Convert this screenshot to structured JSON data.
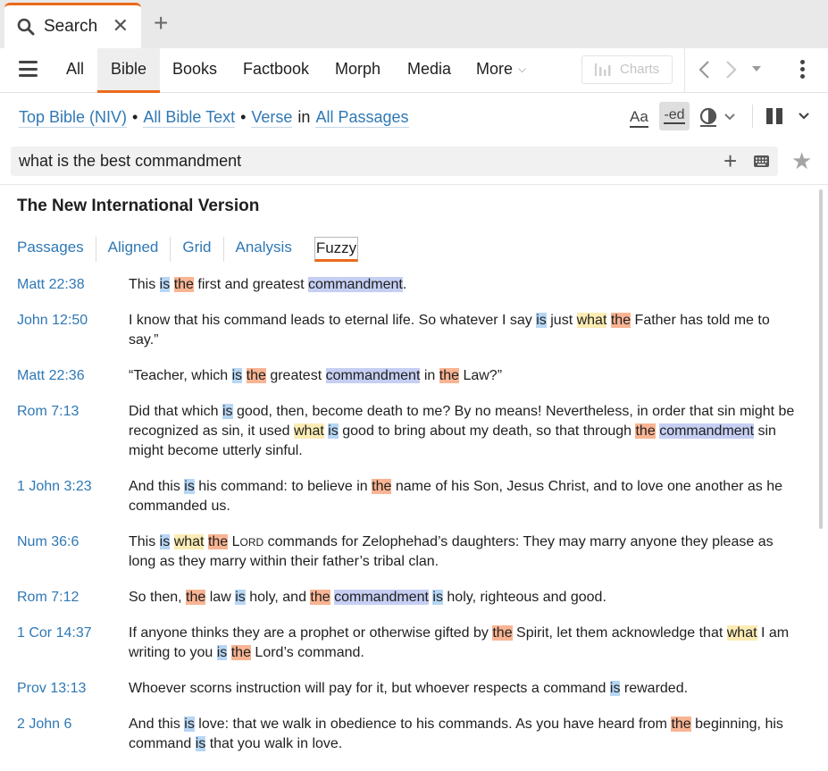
{
  "tab": {
    "label": "Search",
    "close": "✕",
    "icon": "search-icon"
  },
  "new_tab": "+",
  "toolbar": {
    "menu_icon": "hamburger-menu-icon",
    "tabs": [
      "All",
      "Bible",
      "Books",
      "Factbook",
      "Morph",
      "Media",
      "More"
    ],
    "active_tab": "Bible",
    "charts_label": "Charts",
    "back": "‹",
    "forward": "›",
    "history_dropdown": "▾"
  },
  "scope": {
    "bible": "Top Bible (NIV)",
    "sep1": "•",
    "text_scope": "All Bible Text",
    "sep2": "•",
    "unit": "Verse",
    "in": "in",
    "range": "All Passages"
  },
  "search_options": {
    "match_case": "Aa",
    "match_prefix": "-ed"
  },
  "search": {
    "query": "what is the best commandment",
    "add": "+"
  },
  "result": {
    "title": "The New International Version",
    "view_tabs": [
      "Passages",
      "Aligned",
      "Grid",
      "Analysis",
      "Fuzzy"
    ],
    "active_view": "Fuzzy"
  },
  "colors": {
    "accent": "#ea6a1b",
    "link": "#2f78b5",
    "highlight_is": "#b7d6f4",
    "highlight_the": "#f9b493",
    "highlight_what": "#fcecb4",
    "highlight_commandment": "#c6cff3"
  },
  "results": [
    {
      "ref": "Matt 22:38",
      "segments": [
        [
          "This ",
          ""
        ],
        [
          "is",
          "blue"
        ],
        [
          " ",
          ""
        ],
        [
          "the",
          "orange"
        ],
        [
          " first and greatest ",
          ""
        ],
        [
          "commandment",
          "purple"
        ],
        [
          ".",
          ""
        ]
      ]
    },
    {
      "ref": "John 12:50",
      "segments": [
        [
          "I know that his command leads to eternal life. So whatever I say ",
          ""
        ],
        [
          "is",
          "blue"
        ],
        [
          " just ",
          ""
        ],
        [
          "what",
          "yellow"
        ],
        [
          " ",
          ""
        ],
        [
          "the",
          "orange"
        ],
        [
          " Father has told me to say.”",
          ""
        ]
      ]
    },
    {
      "ref": "Matt 22:36",
      "segments": [
        [
          "“Teacher, which ",
          ""
        ],
        [
          "is",
          "blue"
        ],
        [
          " ",
          ""
        ],
        [
          "the",
          "orange"
        ],
        [
          " greatest ",
          ""
        ],
        [
          "commandment",
          "purple"
        ],
        [
          " in ",
          ""
        ],
        [
          "the",
          "orange"
        ],
        [
          " Law?”",
          ""
        ]
      ]
    },
    {
      "ref": "Rom 7:13",
      "segments": [
        [
          "Did that which ",
          ""
        ],
        [
          "is",
          "blue"
        ],
        [
          " good, then, become death to me? By no means! Nevertheless, in order that sin might be recognized as sin, it used ",
          ""
        ],
        [
          "what",
          "yellow"
        ],
        [
          " ",
          ""
        ],
        [
          "is",
          "blue"
        ],
        [
          " good to bring about my death, so that through ",
          ""
        ],
        [
          "the",
          "orange"
        ],
        [
          " ",
          ""
        ],
        [
          "commandment",
          "purple"
        ],
        [
          " sin might become utterly sinful.",
          ""
        ]
      ]
    },
    {
      "ref": "1 John 3:23",
      "segments": [
        [
          "And this ",
          ""
        ],
        [
          "is",
          "blue"
        ],
        [
          " his command: to believe in ",
          ""
        ],
        [
          "the",
          "orange"
        ],
        [
          " name of his Son, Jesus Christ, and to love one another as he commanded us.",
          ""
        ]
      ]
    },
    {
      "ref": "Num 36:6",
      "segments": [
        [
          "This ",
          ""
        ],
        [
          "is",
          "blue"
        ],
        [
          " ",
          ""
        ],
        [
          "what",
          "yellow"
        ],
        [
          " ",
          ""
        ],
        [
          "the",
          "orange"
        ],
        [
          " L",
          ""
        ],
        [
          "ORD",
          "sc"
        ],
        [
          " commands for Zelophehad’s daughters: They may marry anyone they please as long as they marry within their father’s tribal clan.",
          ""
        ]
      ]
    },
    {
      "ref": "Rom 7:12",
      "segments": [
        [
          "So then, ",
          ""
        ],
        [
          "the",
          "orange"
        ],
        [
          " law ",
          ""
        ],
        [
          "is",
          "blue"
        ],
        [
          " holy, and ",
          ""
        ],
        [
          "the",
          "orange"
        ],
        [
          " ",
          ""
        ],
        [
          "commandment",
          "purple"
        ],
        [
          " ",
          ""
        ],
        [
          "is",
          "blue"
        ],
        [
          " holy, righteous and good.",
          ""
        ]
      ]
    },
    {
      "ref": "1 Cor 14:37",
      "segments": [
        [
          "If anyone thinks they are a prophet or otherwise gifted by ",
          ""
        ],
        [
          "the",
          "orange"
        ],
        [
          " Spirit, let them acknowledge that ",
          ""
        ],
        [
          "what",
          "yellow"
        ],
        [
          " I am writing to you ",
          ""
        ],
        [
          "is",
          "blue"
        ],
        [
          " ",
          ""
        ],
        [
          "the",
          "orange"
        ],
        [
          " Lord’s command.",
          ""
        ]
      ]
    },
    {
      "ref": "Prov 13:13",
      "segments": [
        [
          "Whoever scorns instruction will pay for it, but whoever respects a command ",
          ""
        ],
        [
          "is",
          "blue"
        ],
        [
          " rewarded.",
          ""
        ]
      ]
    },
    {
      "ref": "2 John 6",
      "segments": [
        [
          "And this ",
          ""
        ],
        [
          "is",
          "blue"
        ],
        [
          " love: that we walk in obedience to his commands. As you have heard from ",
          ""
        ],
        [
          "the",
          "orange"
        ],
        [
          " beginning, his command ",
          ""
        ],
        [
          "is",
          "blue"
        ],
        [
          " that you walk in love.",
          ""
        ]
      ]
    }
  ]
}
